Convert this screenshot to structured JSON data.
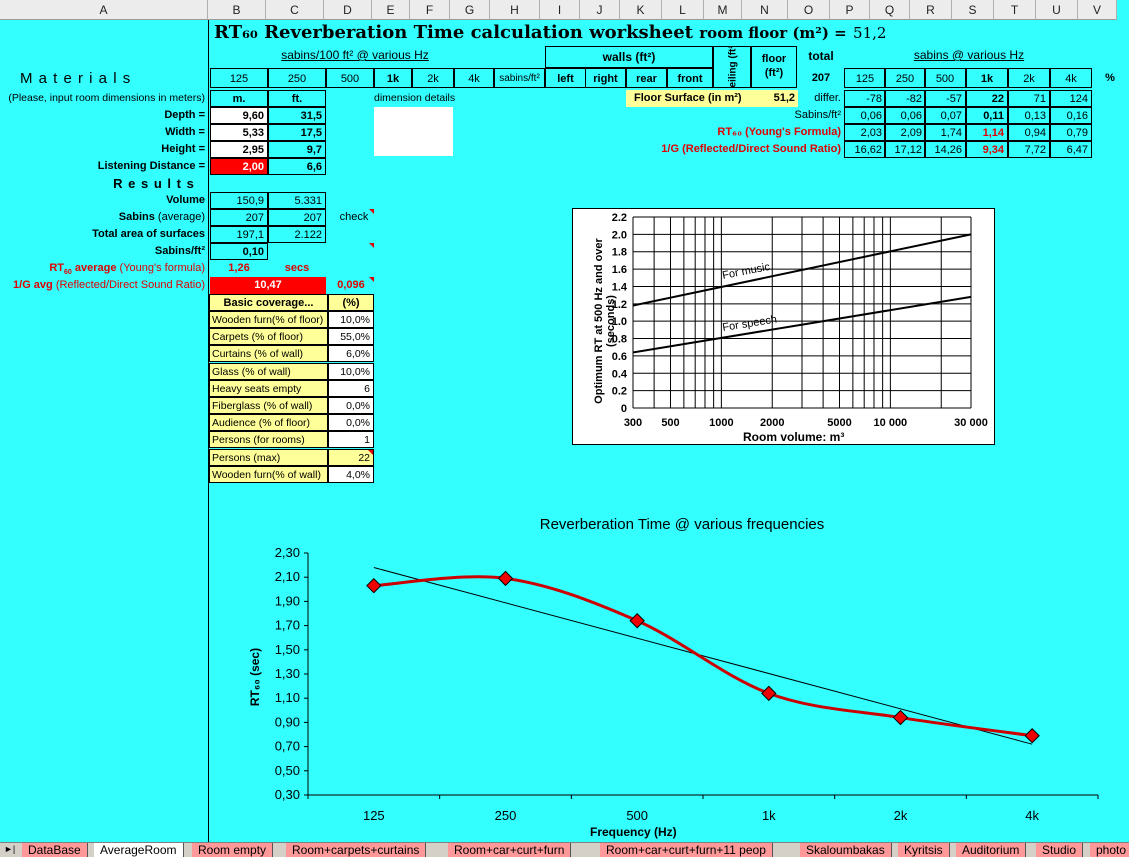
{
  "columns": [
    "A",
    "B",
    "C",
    "D",
    "E",
    "F",
    "G",
    "H",
    "I",
    "J",
    "K",
    "L",
    "M",
    "N",
    "O",
    "P",
    "Q",
    "R",
    "S",
    "T",
    "U",
    "V"
  ],
  "title": {
    "main": "RT₆₀ Reverberation Time calculation worksheet",
    "room_floor_label": "room floor (m²) =",
    "room_floor_value": "51,2"
  },
  "header": {
    "sabins_per_100": "sabins/100 ft² @ various Hz",
    "walls": "walls (ft²)",
    "ceiling": "ceiling (ft²)",
    "floor": "floor (ft²)",
    "total": "total",
    "total_value": "207",
    "sabins_various": "sabins @ various Hz",
    "materials": "M a t e r i a l s",
    "freqs": [
      "125",
      "250",
      "500",
      "1k",
      "2k",
      "4k"
    ],
    "sabins_ft2": "sabins/ft²",
    "wall_cols": [
      "left",
      "right",
      "rear",
      "front"
    ],
    "percent": "%"
  },
  "dimensions": {
    "note": "(Please, input room dimensions in meters)",
    "unit_m": "m.",
    "unit_ft": "ft.",
    "details": "dimension details",
    "rows": [
      {
        "label": "Depth =",
        "m": "9,60",
        "ft": "31,5"
      },
      {
        "label": "Width =",
        "m": "5,33",
        "ft": "17,5"
      },
      {
        "label": "Height =",
        "m": "2,95",
        "ft": "9,7"
      },
      {
        "label": "Listening Distance =",
        "m": "2,00",
        "ft": "6,6"
      }
    ]
  },
  "floor_surface": {
    "label": "Floor Surface (in m²)",
    "value": "51,2"
  },
  "right_table": {
    "rows": [
      {
        "label": "differ.",
        "values": [
          "-78",
          "-82",
          "-57",
          "22",
          "71",
          "124"
        ]
      },
      {
        "label": "Sabins/ft²",
        "values": [
          "0,06",
          "0,06",
          "0,07",
          "0,11",
          "0,13",
          "0,16"
        ]
      },
      {
        "label": "RT₆₀ (Young's Formula)",
        "values": [
          "2,03",
          "2,09",
          "1,74",
          "1,14",
          "0,94",
          "0,79"
        ]
      },
      {
        "label": "1/G (Reflected/Direct Sound Ratio)",
        "values": [
          "16,62",
          "17,12",
          "14,26",
          "9,34",
          "7,72",
          "6,47"
        ]
      }
    ]
  },
  "results": {
    "heading": "R e s u l t s",
    "volume": {
      "label": "Volume",
      "m": "150,9",
      "ft": "5.331"
    },
    "sabins_avg": {
      "label": "Sabins (average)",
      "m": "207",
      "ft": "207",
      "note": "check"
    },
    "total_area": {
      "label": "Total area of surfaces",
      "m": "197,1",
      "ft": "2.122"
    },
    "sabins_ft2": {
      "label": "Sabins/ft²",
      "m": "0,10"
    },
    "rt60_avg": {
      "label": "RT₆₀ average (Young's formula)",
      "value": "1,26",
      "unit": "secs"
    },
    "g_avg": {
      "label": "1/G avg (Reflected/Direct Sound Ratio)",
      "value": "10,47",
      "extra": "0,096"
    }
  },
  "coverage": {
    "header": "Basic coverage...",
    "header_pct": "(%)",
    "rows": [
      {
        "label": "Wooden furn(% of floor)",
        "value": "10,0%"
      },
      {
        "label": "Carpets (% of floor)",
        "value": "55,0%"
      },
      {
        "label": "Curtains (% of wall)",
        "value": "6,0%"
      },
      {
        "label": "Glass (% of wall)",
        "value": "10,0%"
      },
      {
        "label": "Heavy seats empty",
        "value": "6"
      },
      {
        "label": "Fiberglass (% of wall)",
        "value": "0,0%"
      },
      {
        "label": "Audience (% of floor)",
        "value": "0,0%"
      },
      {
        "label": "Persons (for rooms)",
        "value": "1"
      },
      {
        "label": "Persons (max)",
        "value": "22"
      },
      {
        "label": "Wooden furn(% of wall)",
        "value": "4,0%"
      }
    ]
  },
  "optimum_chart": {
    "ylabel": "Optimum RT at 500 Hz and over (seconds)",
    "xlabel": "Room volume: m³",
    "yticks": [
      "2.2",
      "2.0",
      "1.8",
      "1.6",
      "1.4",
      "1.2",
      "1.0",
      "0.8",
      "0.6",
      "0.4",
      "0.2",
      "0"
    ],
    "xticks": [
      "300",
      "500",
      "1000",
      "2000",
      "5000",
      "10 000",
      "30 000"
    ],
    "music_label": "For music",
    "speech_label": "For speech"
  },
  "chart_data": {
    "type": "line",
    "title": "Reverberation Time @ various frequencies",
    "xlabel": "Frequency (Hz)",
    "ylabel": "RT₆₀ (sec)",
    "categories": [
      "125",
      "250",
      "500",
      "1k",
      "2k",
      "4k"
    ],
    "series": [
      {
        "values": [
          2.03,
          2.09,
          1.74,
          1.14,
          0.94,
          0.79
        ],
        "color": "#cc0000"
      }
    ],
    "trend": {
      "start": 2.18,
      "end": 0.72,
      "color": "#000000"
    },
    "ylim": [
      0.3,
      2.3
    ],
    "yticks": [
      "2,30",
      "2,10",
      "1,90",
      "1,70",
      "1,50",
      "1,30",
      "1,10",
      "0,90",
      "0,70",
      "0,50",
      "0,30"
    ],
    "grid": false
  },
  "tabs": [
    "DataBase",
    "AverageRoom",
    "Room empty",
    "Room+carpets+curtains",
    "Room+car+curt+furn",
    "Room+car+curt+furn+11 peop",
    "Skaloumbakas",
    "Kyritsis",
    "Auditorium",
    "Studio",
    "photo"
  ],
  "active_tab": "AverageRoom",
  "colors": {
    "background": "#33ffff",
    "input_red": "#ff0000",
    "highlight_yellow": "#ffff99"
  }
}
